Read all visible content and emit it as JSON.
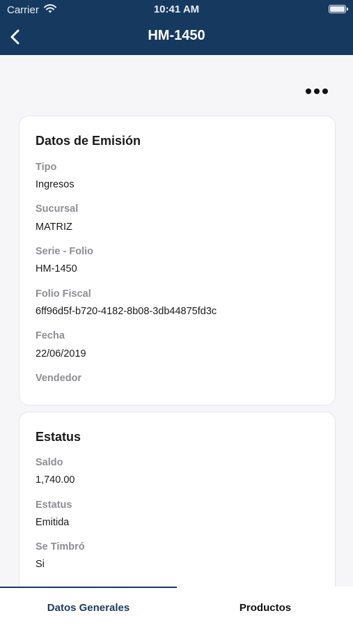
{
  "status_bar": {
    "carrier": "Carrier",
    "time": "10:41 AM"
  },
  "nav": {
    "title": "HM-1450",
    "back_icon": "chevron-left-icon"
  },
  "actions": {
    "more_icon": "ellipsis-icon"
  },
  "emision": {
    "title": "Datos de Emisión",
    "fields": [
      {
        "label": "Tipo",
        "value": "Ingresos"
      },
      {
        "label": "Sucursal",
        "value": "MATRIZ"
      },
      {
        "label": "Serie - Folio",
        "value": "HM-1450"
      },
      {
        "label": "Folio Fiscal",
        "value": "6ff96d5f-b720-4182-8b08-3db44875fd3c"
      },
      {
        "label": "Fecha",
        "value": "22/06/2019"
      },
      {
        "label": "Vendedor",
        "value": ""
      }
    ]
  },
  "estatus": {
    "title": "Estatus",
    "fields": [
      {
        "label": "Saldo",
        "value": "1,740.00"
      },
      {
        "label": "Estatus",
        "value": "Emitida"
      },
      {
        "label": "Se Timbró",
        "value": "Si"
      }
    ]
  },
  "tabs": {
    "items": [
      {
        "label": "Datos Generales",
        "active": true
      },
      {
        "label": "Productos",
        "active": false
      }
    ]
  },
  "colors": {
    "nav_bg": "#163a5f",
    "active_tab": "#1e3a5f"
  }
}
